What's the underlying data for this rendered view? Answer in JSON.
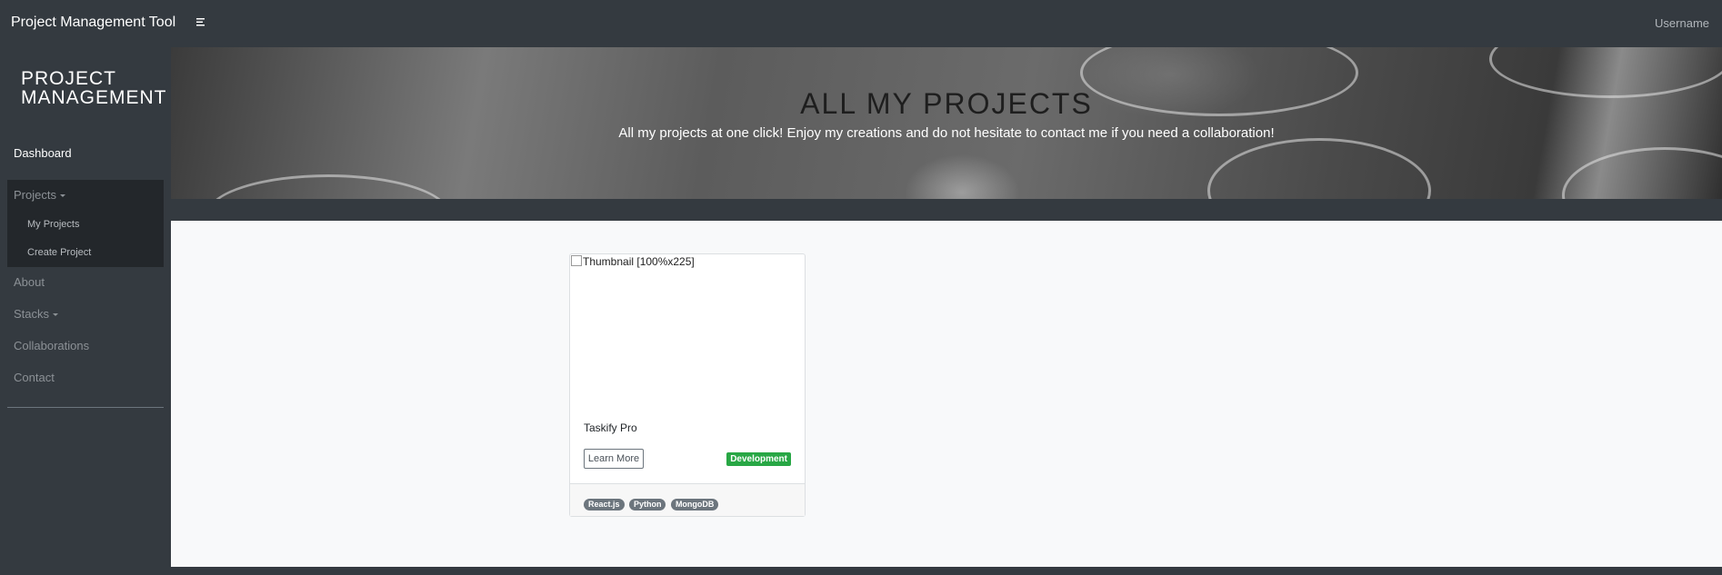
{
  "navbar": {
    "brand": "Project Management Tool",
    "user": "Username"
  },
  "sidebar": {
    "title_line1": "PROJECT",
    "title_line2": "MANAGEMENT",
    "items": [
      {
        "label": "Dashboard"
      },
      {
        "label": "Projects"
      },
      {
        "label": "About"
      },
      {
        "label": "Stacks"
      },
      {
        "label": "Collaborations"
      },
      {
        "label": "Contact"
      }
    ],
    "projects_sub": [
      {
        "label": "My Projects"
      },
      {
        "label": "Create Project"
      }
    ]
  },
  "hero": {
    "title": "ALL MY PROJECTS",
    "subtitle": "All my projects at one click! Enjoy my creations and do not hesitate to contact me if you need a collaboration!"
  },
  "card": {
    "thumbnail_alt": "Thumbnail [100%x225]",
    "title": "Taskify Pro",
    "button": "Learn More",
    "status": "Development",
    "status_color": "#28a745",
    "tags": [
      "React.js",
      "Python",
      "MongoDB"
    ]
  }
}
